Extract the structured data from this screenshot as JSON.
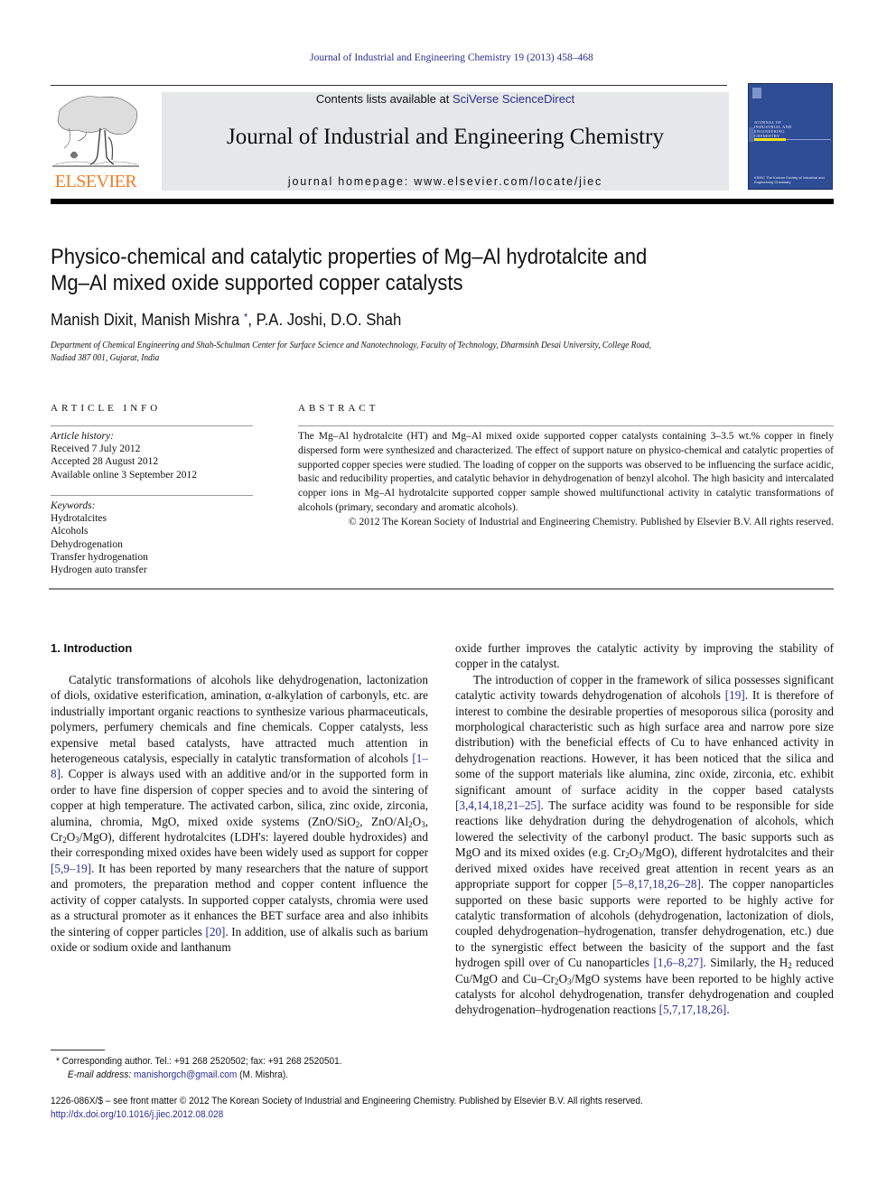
{
  "running_head": "Journal of Industrial and Engineering Chemistry 19 (2013) 458–468",
  "publisher": {
    "logo_word": "ELSEVIER",
    "logo_color": "#f07e26"
  },
  "masthead": {
    "contents_prefix": "Contents lists available at ",
    "contents_link": "SciVerse ScienceDirect",
    "journal_name": "Journal of Industrial and Engineering Chemistry",
    "homepage": "journal homepage: www.elsevier.com/locate/jiec"
  },
  "cover": {
    "title_lines": [
      "JOURNAL OF",
      "INDUSTRIAL AND",
      "ENGINEERING",
      "CHEMISTRY"
    ],
    "bottom_text": "KSIEC The Korean Society of Industrial and Engineering Chemistry",
    "color": "#2e4d96"
  },
  "article": {
    "title_line1": "Physico-chemical and catalytic properties of Mg–Al hydrotalcite and",
    "title_line2": "Mg–Al mixed oxide supported copper catalysts",
    "authors": "Manish Dixit, Manish Mishra",
    "authors_star": "*",
    "authors_rest": ", P.A. Joshi, D.O. Shah",
    "affiliation_line1": "Department of Chemical Engineering and Shah-Schulman Center for Surface Science and Nanotechnology, Faculty of Technology, Dharmsinh Desai University, College Road,",
    "affiliation_line2": "Nadiad 387 001, Gujarat, India"
  },
  "article_info": {
    "heading": "ARTICLE INFO",
    "history_label": "Article history:",
    "history": [
      "Received 7 July 2012",
      "Accepted 28 August 2012",
      "Available online 3 September 2012"
    ],
    "keywords_label": "Keywords:",
    "keywords": [
      "Hydrotalcites",
      "Alcohols",
      "Dehydrogenation",
      "Transfer hydrogenation",
      "Hydrogen auto transfer"
    ]
  },
  "abstract": {
    "heading": "ABSTRACT",
    "text": "The Mg–Al hydrotalcite (HT) and Mg–Al mixed oxide supported copper catalysts containing 3–3.5 wt.% copper in finely dispersed form were synthesized and characterized. The effect of support nature on physico-chemical and catalytic properties of supported copper species were studied. The loading of copper on the supports was observed to be influencing the surface acidic, basic and reducibility properties, and catalytic behavior in dehydrogenation of benzyl alcohol. The high basicity and intercalated copper ions in Mg–Al hydrotalcite supported copper sample showed multifunctional activity in catalytic transformations of alcohols (primary, secondary and aromatic alcohols).",
    "copyright": "© 2012 The Korean Society of Industrial and Engineering Chemistry. Published by Elsevier B.V. All rights reserved."
  },
  "introduction": {
    "heading": "1.  Introduction",
    "left": {
      "p1_a": "Catalytic transformations of alcohols like dehydrogenation, lactonization of diols, oxidative esterification, amination, α-alkylation of carbonyls, etc. are industrially important organic reactions to synthesize various pharmaceuticals, polymers, perfumery chemicals and fine chemicals. Copper catalysts, less expensive metal based catalysts, have attracted much attention in heterogeneous catalysis, especially in catalytic transformation of alcohols ",
      "ref1": "[1–8]",
      "p1_b": ". Copper is always used with an additive and/or in the supported form in order to have fine dispersion of copper species and to avoid the sintering of copper at high temperature. The activated carbon, silica, zinc oxide, zirconia, alumina, chromia, MgO, mixed oxide systems (ZnO/SiO",
      "p1_c": ", ZnO/Al",
      "p1_d": "O",
      "p1_e": ", Cr",
      "p1_f": "O",
      "p1_g": "/MgO), different hydrotalcites (LDH's: layered double hydroxides) and their corresponding mixed oxides have been widely used as support for copper ",
      "ref2": "[5,9–19]",
      "p1_h": ". It has been reported by many researchers that the nature of support and promoters, the preparation method and copper content influence the activity of copper catalysts. In supported copper catalysts, chromia were used as a structural promoter as it enhances the BET surface area and also inhibits the sintering of copper particles ",
      "ref3": "[20]",
      "p1_i": ". In addition, use of alkalis such as barium oxide or sodium oxide and lanthanum"
    },
    "right": {
      "p1_end": "oxide further improves the catalytic activity by improving the stability of copper in the catalyst.",
      "p2_a": "The introduction of copper in the framework of silica possesses significant catalytic activity towards dehydrogenation of alcohols ",
      "ref4": "[19]",
      "p2_b": ". It is therefore of interest to combine the desirable properties of mesoporous silica (porosity and morphological characteristic such as high surface area and narrow pore size distribution) with the beneficial effects of Cu to have enhanced activity in dehydrogenation reactions. However, it has been noticed that the silica and some of the support materials like alumina, zinc oxide, zirconia, etc. exhibit significant amount of surface acidity in the copper based catalysts ",
      "ref5": "[3,4,14,18,21–25]",
      "p2_c": ". The surface acidity was found to be responsible for side reactions like dehydration during the dehydrogenation of alcohols, which lowered the selectivity of the carbonyl product. The basic supports such as MgO and its mixed oxides (e.g. Cr",
      "p2_d": "O",
      "p2_e": "/MgO), different hydrotalcites and their derived mixed oxides have received great attention in recent years as an appropriate support for copper ",
      "ref6": "[5–8,17,18,26–28]",
      "p2_f": ". The copper nanoparticles supported on these basic supports were reported to be highly active for catalytic transformation of alcohols (dehydrogenation, lactonization of diols, coupled dehydrogenation–hydrogenation, transfer dehydrogenation, etc.) due to the synergistic effect between the basicity of the support and the fast hydrogen spill over of Cu nanoparticles ",
      "ref7": "[1,6–8,27]",
      "p2_g": ". Similarly, the H",
      "p2_h": " reduced Cu/MgO and Cu–Cr",
      "p2_i": "O",
      "p2_j": "/MgO systems have been reported to be highly active catalysts for alcohol dehydrogenation, transfer dehydrogenation and coupled dehydrogenation–hydrogenation reactions ",
      "ref8": "[5,7,17,18,26]",
      "p2_k": "."
    },
    "sub2": "2",
    "sub3": "3"
  },
  "footnote": {
    "star": "*",
    "corresponding": " Corresponding author. Tel.: +91 268 2520502; fax: +91 268 2520501.",
    "email_label": "E-mail address:",
    "email": "manishorgch@gmail.com",
    "email_suffix": " (M. Mishra)."
  },
  "issn_line": "1226-086X/$ – see front matter © 2012 The Korean Society of Industrial and Engineering Chemistry. Published by Elsevier B.V. All rights reserved.",
  "doi": "http://dx.doi.org/10.1016/j.jiec.2012.08.028",
  "colors": {
    "link": "#2a2f8f",
    "masthead_bg": "#e6e7e8"
  }
}
